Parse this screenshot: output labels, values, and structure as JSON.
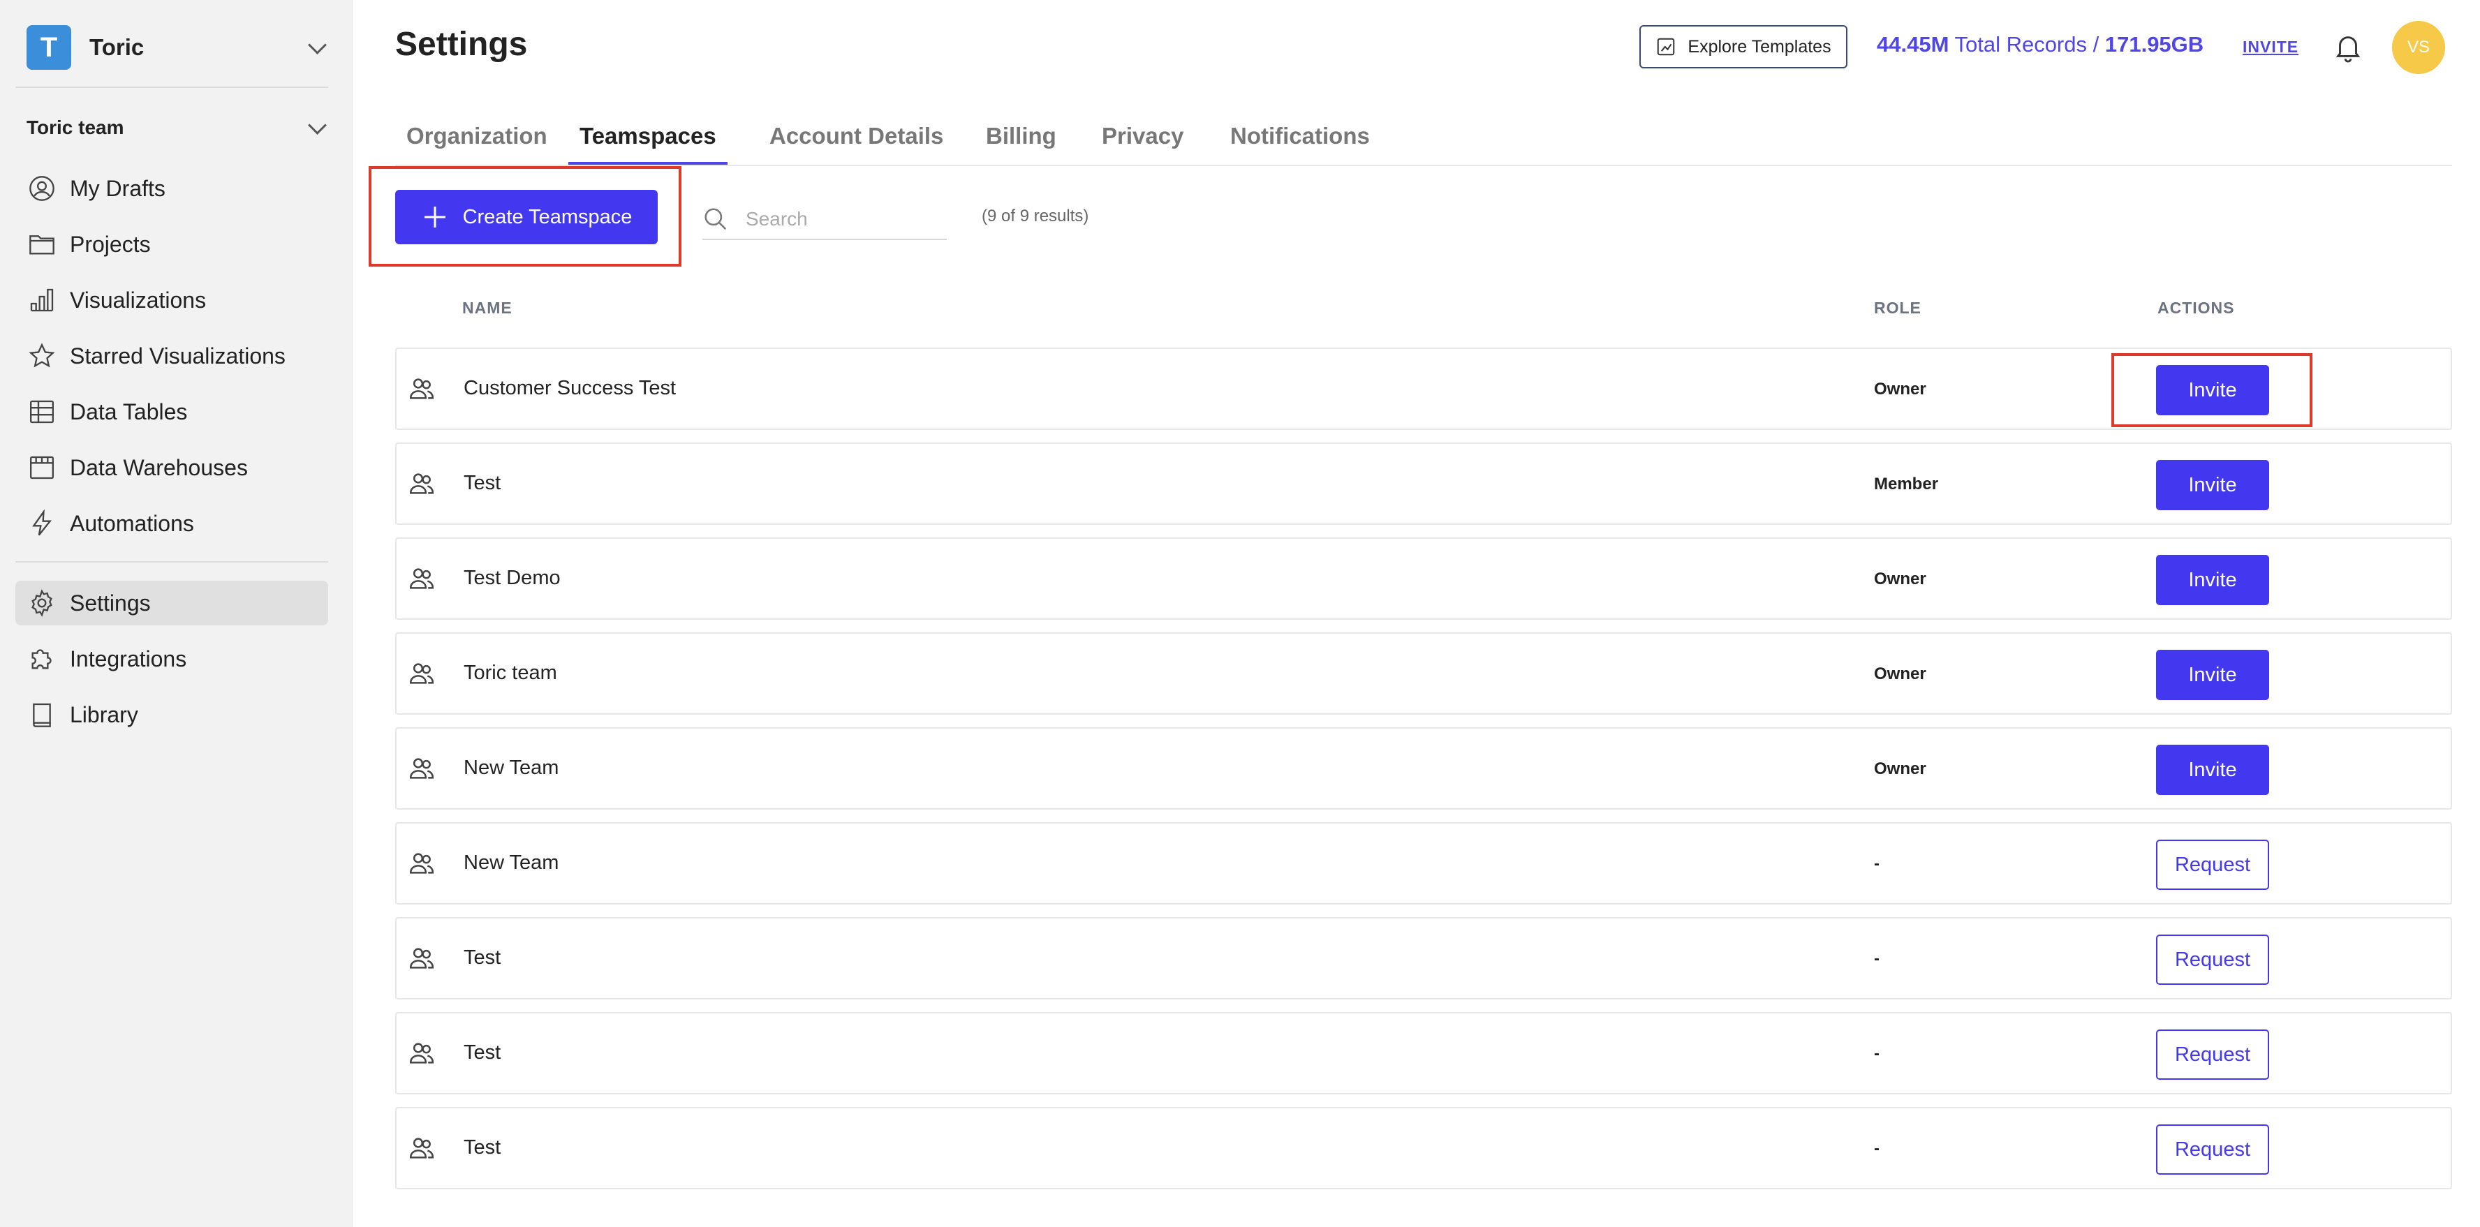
{
  "sidebar": {
    "workspace": {
      "initial": "T",
      "name": "Toric"
    },
    "team_label": "Toric team",
    "items": [
      {
        "label": "My Drafts",
        "icon": "user-circle-icon"
      },
      {
        "label": "Projects",
        "icon": "folder-icon"
      },
      {
        "label": "Visualizations",
        "icon": "chart-icon"
      },
      {
        "label": "Starred Visualizations",
        "icon": "star-icon"
      },
      {
        "label": "Data Tables",
        "icon": "table-icon"
      },
      {
        "label": "Data Warehouses",
        "icon": "warehouse-icon"
      },
      {
        "label": "Automations",
        "icon": "lightning-icon"
      },
      {
        "label": "Settings",
        "icon": "gear-icon",
        "active": true
      },
      {
        "label": "Integrations",
        "icon": "puzzle-icon"
      },
      {
        "label": "Library",
        "icon": "book-icon"
      }
    ]
  },
  "header": {
    "title": "Settings",
    "explore_templates": "Explore Templates",
    "records_count": "44.45M",
    "records_label": "Total Records /",
    "storage": "171.95GB",
    "invite": "INVITE",
    "avatar_initials": "VS"
  },
  "tabs": [
    {
      "label": "Organization"
    },
    {
      "label": "Teamspaces",
      "active": true
    },
    {
      "label": "Account Details"
    },
    {
      "label": "Billing"
    },
    {
      "label": "Privacy"
    },
    {
      "label": "Notifications"
    }
  ],
  "toolbar": {
    "create_label": "Create Teamspace",
    "search_placeholder": "Search",
    "results_text": "(9 of 9 results)"
  },
  "table": {
    "columns": {
      "name": "NAME",
      "role": "ROLE",
      "actions": "ACTIONS"
    },
    "rows": [
      {
        "name": "Customer Success Test",
        "role": "Owner",
        "action": "Invite"
      },
      {
        "name": "Test",
        "role": "Member",
        "action": "Invite"
      },
      {
        "name": "Test Demo",
        "role": "Owner",
        "action": "Invite"
      },
      {
        "name": "Toric team",
        "role": "Owner",
        "action": "Invite"
      },
      {
        "name": "New Team",
        "role": "Owner",
        "action": "Invite"
      },
      {
        "name": "New Team",
        "role": "-",
        "action": "Request"
      },
      {
        "name": "Test",
        "role": "-",
        "action": "Request"
      },
      {
        "name": "Test",
        "role": "-",
        "action": "Request"
      },
      {
        "name": "Test",
        "role": "-",
        "action": "Request"
      }
    ]
  },
  "colors": {
    "accent": "#4338ef",
    "highlight": "#e0392b",
    "avatar": "#f7c948",
    "logo": "#3b8ed9"
  }
}
